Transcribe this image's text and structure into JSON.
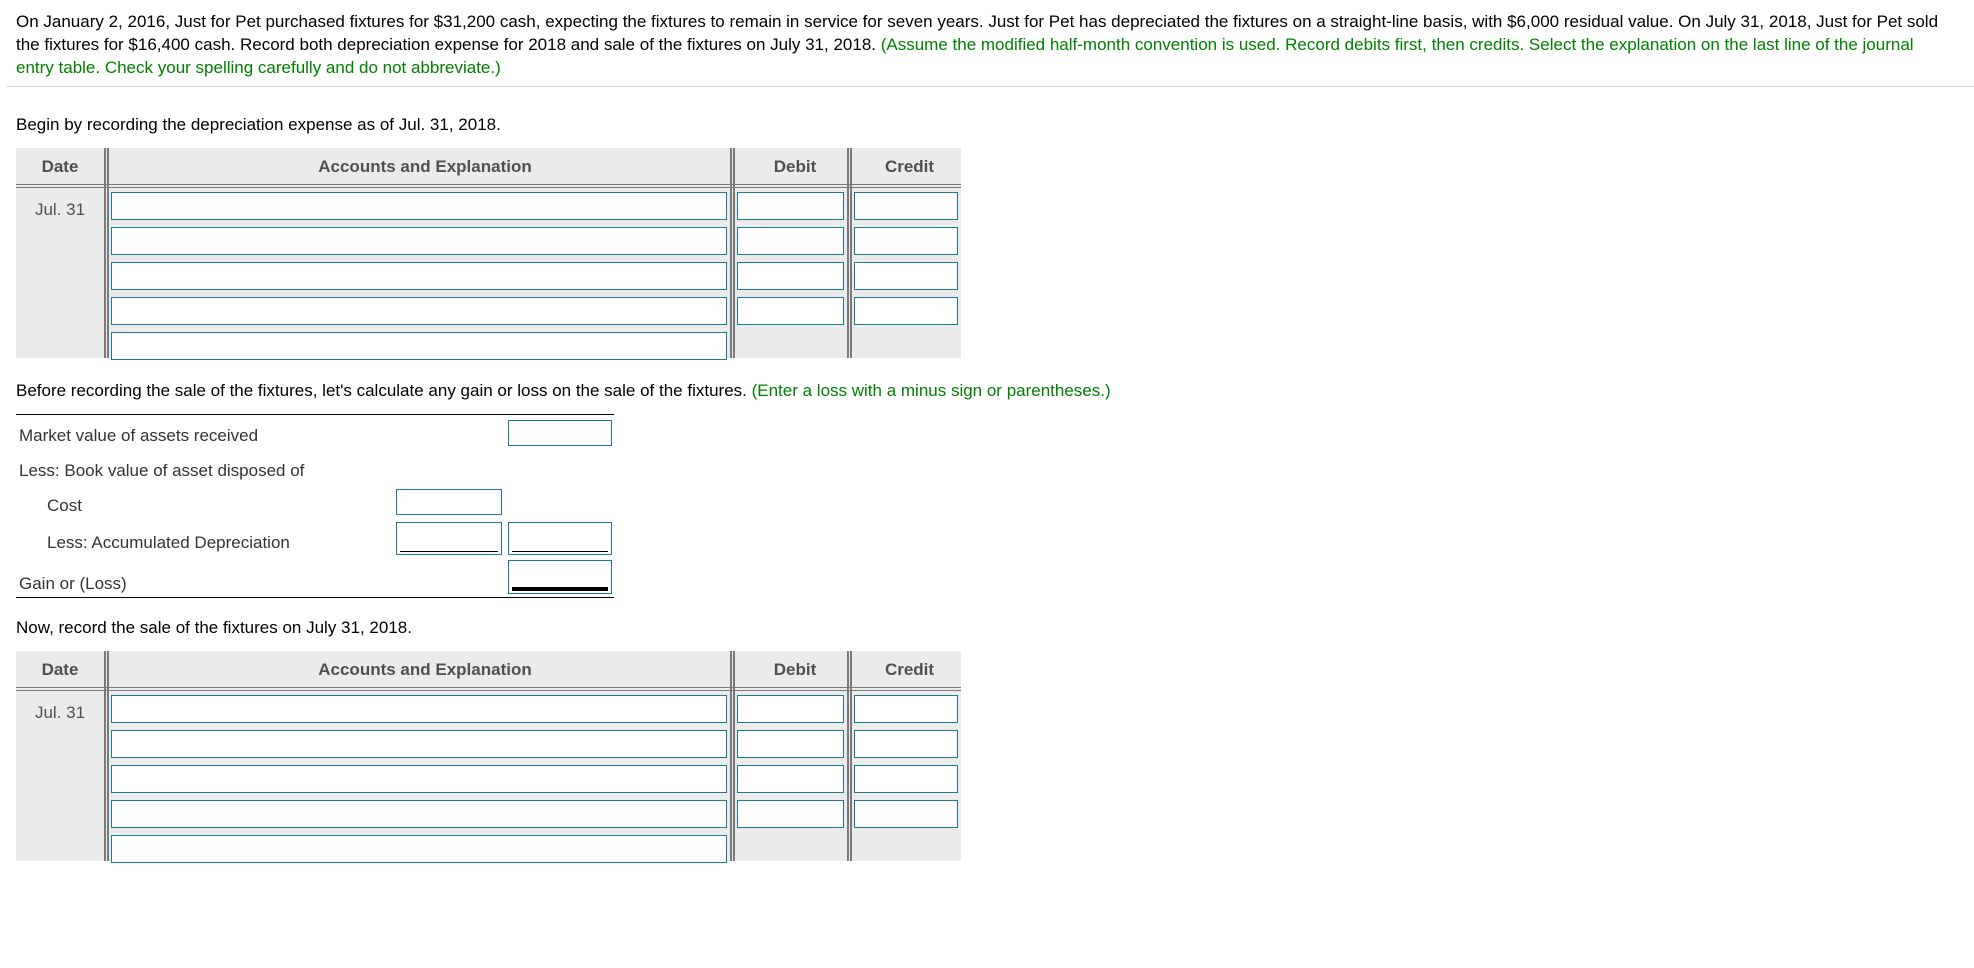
{
  "problem": {
    "text": "On January 2, 2016, Just for Pet purchased fixtures for $31,200 cash, expecting the fixtures to remain in service for seven years. Just for Pet has depreciated the fixtures on a straight-line basis, with $6,000 residual value. On July 31, 2018, Just for Pet sold the fixtures for $16,400 cash. Record both depreciation expense for 2018 and sale of the fixtures on July 31, 2018. ",
    "instructions": "(Assume the modified half-month convention is used. Record debits first, then credits. Select the explanation on the last line of the journal entry table. Check your spelling carefully and do not abbreviate.)"
  },
  "part1": {
    "prompt": "Begin by recording the depreciation expense as of Jul. 31, 2018.",
    "table": {
      "headers": {
        "date": "Date",
        "accounts": "Accounts and Explanation",
        "debit": "Debit",
        "credit": "Credit"
      },
      "date": "Jul. 31",
      "rows": [
        {
          "account": "",
          "debit": "",
          "credit": ""
        },
        {
          "account": "",
          "debit": "",
          "credit": ""
        },
        {
          "account": "",
          "debit": "",
          "credit": ""
        },
        {
          "account": "",
          "debit": "",
          "credit": ""
        }
      ],
      "explanation": ""
    }
  },
  "part2": {
    "prompt": "Before recording the sale of the fixtures, let's calculate any gain or loss on the sale of the fixtures. ",
    "hint": "(Enter a loss with a minus sign or parentheses.)",
    "labels": {
      "market_value": "Market value of assets received",
      "less_book": "Less: Book value of asset disposed of",
      "cost": "Cost",
      "less_accum": "Less: Accumulated Depreciation",
      "gain_loss": "Gain or (Loss)"
    },
    "values": {
      "market_value": "",
      "cost": "",
      "accum_dep": "",
      "book_value": "",
      "gain_loss": ""
    }
  },
  "part3": {
    "prompt": "Now, record the sale of the fixtures on July 31, 2018.",
    "table": {
      "headers": {
        "date": "Date",
        "accounts": "Accounts and Explanation",
        "debit": "Debit",
        "credit": "Credit"
      },
      "date": "Jul. 31",
      "rows": [
        {
          "account": "",
          "debit": "",
          "credit": ""
        },
        {
          "account": "",
          "debit": "",
          "credit": ""
        },
        {
          "account": "",
          "debit": "",
          "credit": ""
        },
        {
          "account": "",
          "debit": "",
          "credit": ""
        }
      ],
      "explanation": ""
    }
  }
}
